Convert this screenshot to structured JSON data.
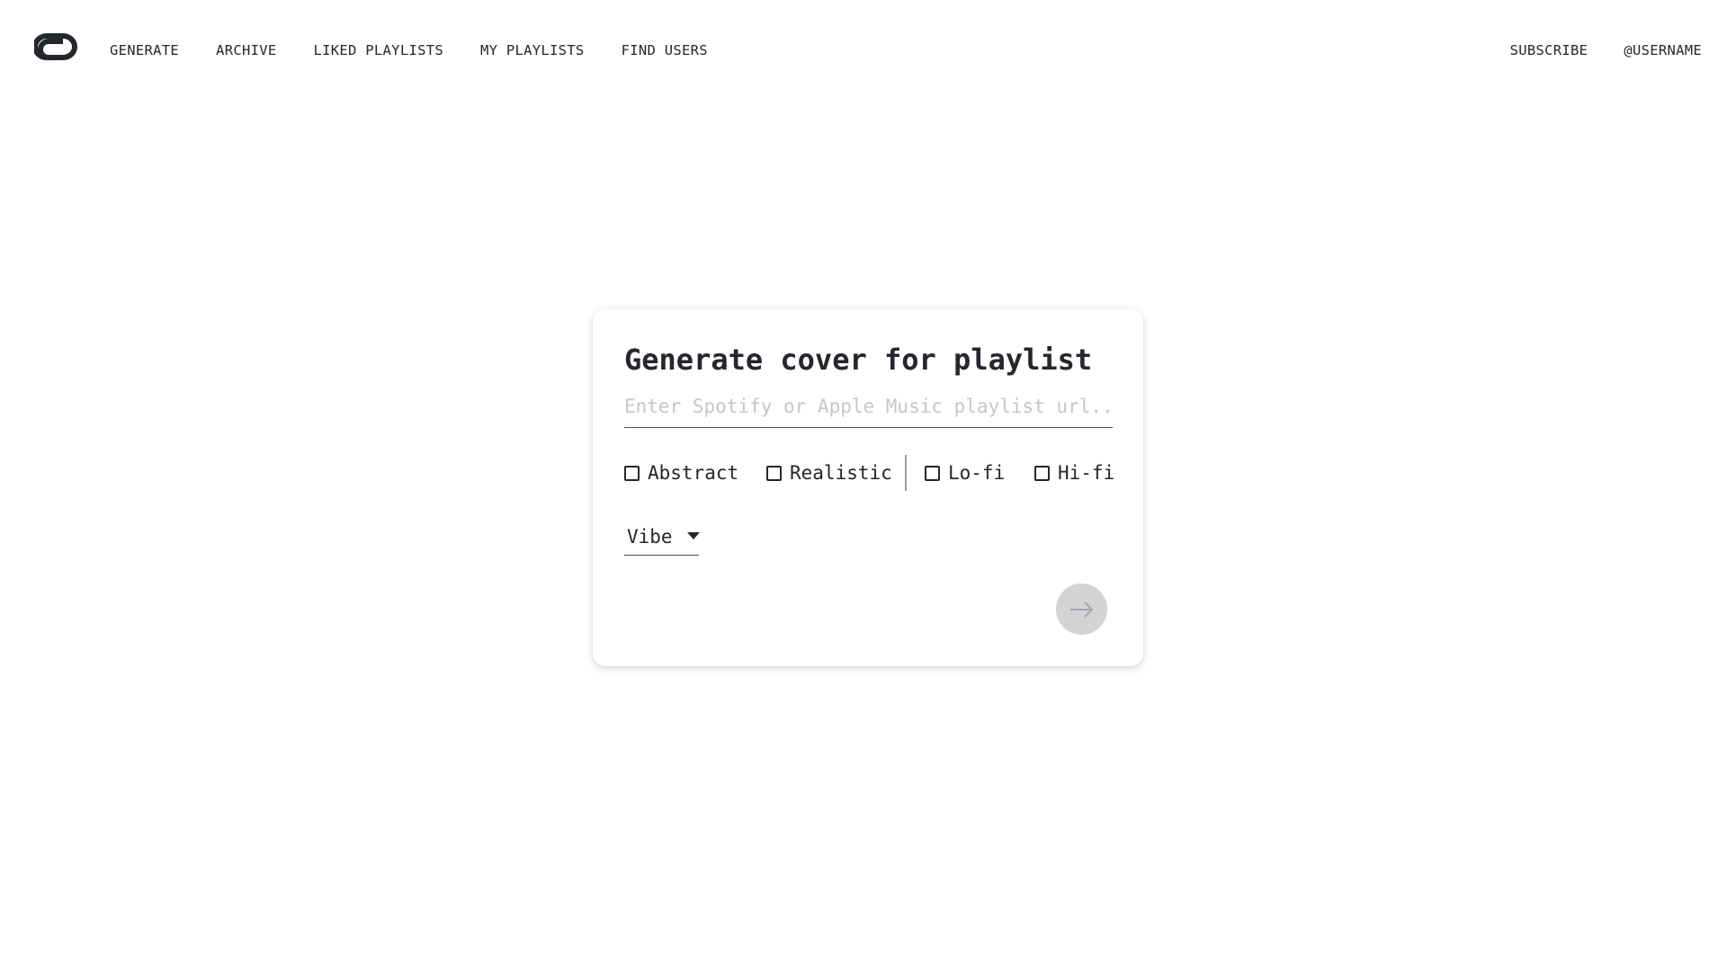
{
  "nav": {
    "links": [
      "GENERATE",
      "ARCHIVE",
      "LIKED PLAYLISTS",
      "MY PLAYLISTS",
      "FIND USERS"
    ],
    "subscribe": "SUBSCRIBE",
    "username": "@USERNAME"
  },
  "card": {
    "title": "Generate cover for playlist",
    "url_placeholder": "Enter Spotify or Apple Music playlist url...",
    "url_value": "",
    "style_options": [
      {
        "label": "Abstract",
        "checked": false
      },
      {
        "label": "Realistic",
        "checked": false
      }
    ],
    "fidelity_options": [
      {
        "label": "Lo-fi",
        "checked": false
      },
      {
        "label": "Hi-fi",
        "checked": false
      }
    ],
    "vibe_select": "Vibe",
    "submit_icon": "arrow-right-icon"
  },
  "colors": {
    "text": "#24272b",
    "placeholder": "#c4c6c9",
    "submit_disabled": "#d1d3d5"
  }
}
